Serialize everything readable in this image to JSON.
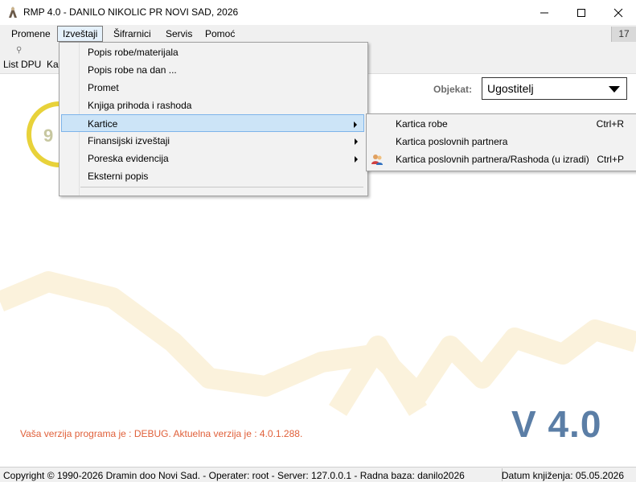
{
  "window": {
    "title": "RMP 4.0 - DANILO NIKOLIC PR NOVI SAD, 2026",
    "app_icon": "app-icon"
  },
  "menubar": {
    "items": [
      "Promene",
      "Izveštaji",
      "Šifrarnici",
      "Servis",
      "Pomoć"
    ],
    "badge": "17"
  },
  "toolbar": {
    "list_dpu": "List DPU",
    "ka": "Ka"
  },
  "objekat": {
    "label": "Objekat:",
    "value": "Ugostitelj"
  },
  "dropdown": {
    "items": [
      {
        "label": "Popis robe/materijala",
        "submenu": false
      },
      {
        "label": "Popis robe na dan ...",
        "submenu": false
      },
      {
        "label": "Promet",
        "submenu": false
      },
      {
        "label": "Knjiga prihoda i rashoda",
        "submenu": false
      },
      {
        "label": "Kartice",
        "submenu": true
      },
      {
        "label": "Finansijski izveštaji",
        "submenu": true
      },
      {
        "label": "Poreska evidencija",
        "submenu": true
      },
      {
        "label": "Eksterni popis",
        "submenu": false
      }
    ]
  },
  "submenu": {
    "items": [
      {
        "label": "Kartica robe",
        "shortcut": "Ctrl+R"
      },
      {
        "label": "Kartica poslovnih partnera",
        "shortcut": ""
      },
      {
        "label": "Kartica poslovnih partnera/Rashoda (u izradi)",
        "shortcut": "Ctrl+P",
        "icon": "users-icon"
      }
    ]
  },
  "version": {
    "message": "Vaša verzija programa je : DEBUG. Aktuelna verzija je : 4.0.1.288.",
    "big": "V 4.0"
  },
  "statusbar": {
    "left": "Copyright © 1990-2026 Dramin doo Novi Sad. - Operater: root - Server: 127.0.0.1 - Radna baza: danilo2026",
    "right": "Datum knjiženja: 05.05.2026"
  },
  "colors": {
    "menu_highlight": "#cce4f7",
    "version_msg": "#e0603a",
    "version_big": "#5b7ea6",
    "logo_ring": "#e8d23a"
  }
}
